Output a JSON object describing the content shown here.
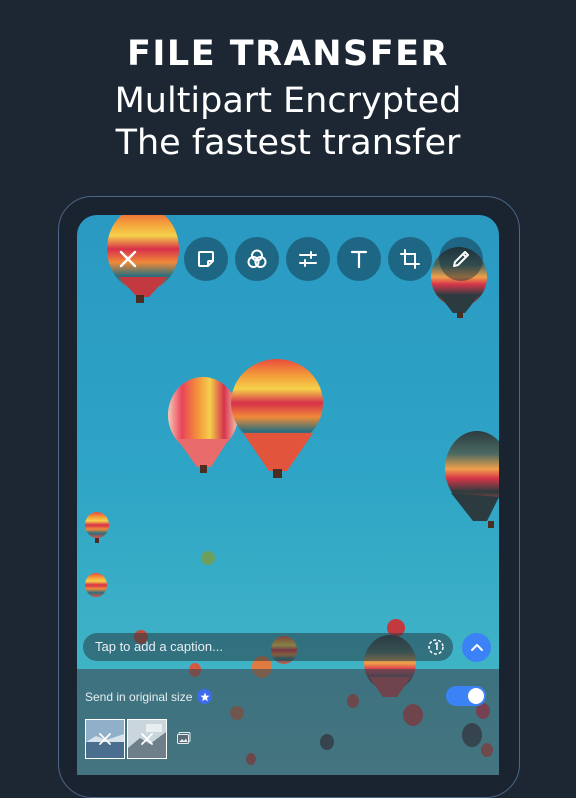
{
  "header": {
    "title": "FILE TRANSFER",
    "line1": "Multipart Encrypted",
    "line2": "The fastest transfer"
  },
  "toolbar": {
    "tools": [
      "close-icon",
      "sticker-icon",
      "filters-icon",
      "adjust-icon",
      "text-icon",
      "crop-icon",
      "draw-icon"
    ]
  },
  "caption": {
    "placeholder": "Tap to add a caption..."
  },
  "options": {
    "send_original_label": "Send in original size",
    "send_original_enabled": true
  },
  "attachments": {
    "count": 2
  },
  "colors": {
    "background": "#1c2733",
    "accent": "#3b82f6",
    "sky": "#2ea4c6"
  }
}
